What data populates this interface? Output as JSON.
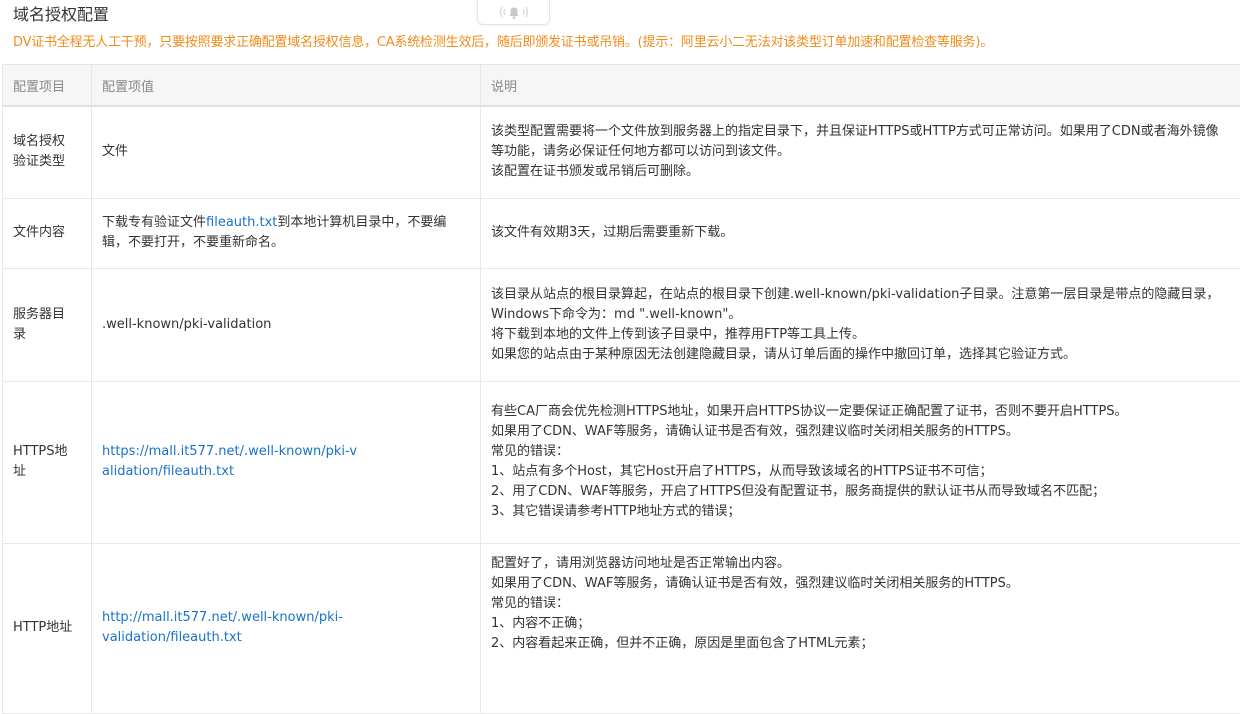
{
  "page": {
    "title": "域名授权配置",
    "notice": "DV证书全程无人工干预，只要按照要求正确配置域名授权信息，CA系统检测生效后，随后即颁发证书或吊销。(提示：阿里云小二无法对该类型订单加速和配置检查等服务)。"
  },
  "colors": {
    "notice": "#f08c1a",
    "link": "#1a73c7",
    "header_bg": "#f6f6f6"
  },
  "bell_widget": {
    "icon": "bell-icon"
  },
  "table": {
    "headers": {
      "item": "配置项目",
      "value": "配置项值",
      "description": "说明"
    },
    "rows": [
      {
        "item": "域名授权验证类型",
        "value_text": "文件",
        "description": [
          "该类型配置需要将一个文件放到服务器上的指定目录下，并且保证HTTPS或HTTP方式可正常访问。如果用了CDN或者海外镜像等功能，请务必保证任何地方都可以访问到该文件。",
          "该配置在证书颁发或吊销后可删除。"
        ]
      },
      {
        "item": "文件内容",
        "value_prefix": "下载专有验证文件",
        "value_link": "fileauth.txt",
        "value_suffix": "到本地计算机目录中，不要编辑，不要打开，不要重新命名。",
        "description": [
          "该文件有效期3天，过期后需要重新下载。"
        ]
      },
      {
        "item": "服务器目录",
        "value_text": ".well-known/pki-validation",
        "description": [
          "该目录从站点的根目录算起，在站点的根目录下创建.well-known/pki-validation子目录。注意第一层目录是带点的隐藏目录，Windows下命令为：md \".well-known\"。",
          "将下载到本地的文件上传到该子目录中，推荐用FTP等工具上传。",
          "如果您的站点由于某种原因无法创建隐藏目录，请从订单后面的操作中撤回订单，选择其它验证方式。"
        ]
      },
      {
        "item": "HTTPS地址",
        "value_link": "https://mall.it577.net/.well-known/pki-validation/fileauth.txt",
        "description": [
          "有些CA厂商会优先检测HTTPS地址，如果开启HTTPS协议一定要保证正确配置了证书，否则不要开启HTTPS。",
          "如果用了CDN、WAF等服务，请确认证书是否有效，强烈建议临时关闭相关服务的HTTPS。",
          "常见的错误：",
          "1、站点有多个Host，其它Host开启了HTTPS，从而导致该域名的HTTPS证书不可信；",
          "2、用了CDN、WAF等服务，开启了HTTPS但没有配置证书，服务商提供的默认证书从而导致域名不匹配；",
          "3、其它错误请参考HTTP地址方式的错误；"
        ]
      },
      {
        "item": "HTTP地址",
        "value_link": "http://mall.it577.net/.well-known/pki-validation/fileauth.txt",
        "description": [
          "配置好了，请用浏览器访问地址是否正常输出内容。",
          "如果用了CDN、WAF等服务，请确认证书是否有效，强烈建议临时关闭相关服务的HTTPS。",
          "常见的错误：",
          "1、内容不正确；",
          "2、内容看起来正确，但并不正确，原因是里面包含了HTML元素；"
        ]
      }
    ]
  }
}
